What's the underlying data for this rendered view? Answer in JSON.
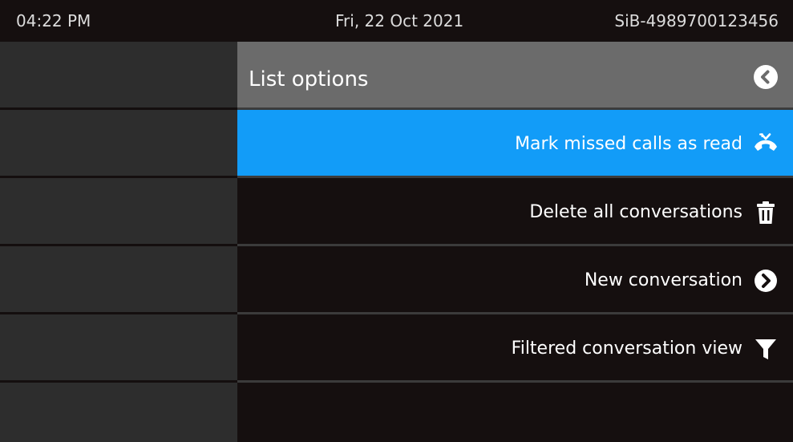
{
  "status_bar": {
    "time": "04:22 PM",
    "date": "Fri, 22 Oct 2021",
    "device_id": "SiB-4989700123456"
  },
  "panel": {
    "title": "List options",
    "back_icon": "chevron-left-circle-icon"
  },
  "options": [
    {
      "label": "Mark missed calls as read",
      "icon": "missed-call-icon",
      "selected": true
    },
    {
      "label": "Delete all conversations",
      "icon": "trash-icon",
      "selected": false
    },
    {
      "label": "New conversation",
      "icon": "chevron-right-circle-icon",
      "selected": false
    },
    {
      "label": "Filtered conversation view",
      "icon": "filter-icon",
      "selected": false
    }
  ],
  "colors": {
    "background": "#140e0e",
    "left_tile": "#2d2d2d",
    "header": "#6b6b6b",
    "selected": "#129cf8",
    "divider": "#3b3b3b",
    "text": "#ffffff",
    "status_text": "#dcdcdc"
  }
}
